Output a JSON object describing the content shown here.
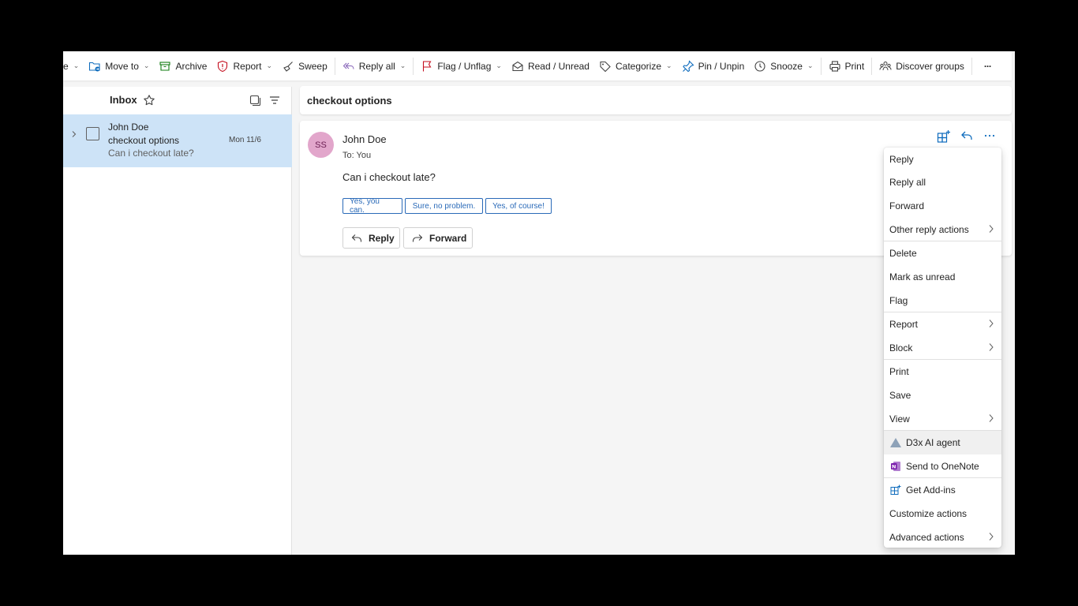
{
  "toolbar": {
    "truncated_label": "e",
    "move_to": "Move to",
    "archive": "Archive",
    "report": "Report",
    "sweep": "Sweep",
    "reply_all": "Reply all",
    "flag_unflag": "Flag / Unflag",
    "read_unread": "Read / Unread",
    "categorize": "Categorize",
    "pin_unpin": "Pin / Unpin",
    "snooze": "Snooze",
    "print": "Print",
    "discover_groups": "Discover groups",
    "more": "···"
  },
  "list": {
    "title": "Inbox",
    "message": {
      "sender": "John Doe",
      "subject": "checkout options",
      "preview": "Can i checkout late?",
      "date": "Mon 11/6"
    }
  },
  "reading": {
    "subject": "checkout options",
    "avatar_initials": "SS",
    "avatar_color": "#e2a6cb",
    "sender": "John Doe",
    "to": "To:  You",
    "body": "Can i checkout late?",
    "suggestions": [
      "Yes, you can.",
      "Sure, no problem.",
      "Yes, of course!"
    ],
    "reply_button": "Reply",
    "forward_button": "Forward"
  },
  "menu": {
    "items": [
      {
        "label": "Reply"
      },
      {
        "label": "Reply all"
      },
      {
        "label": "Forward"
      },
      {
        "label": "Other reply actions"
      },
      {
        "label": "Delete"
      },
      {
        "label": "Mark as unread"
      },
      {
        "label": "Flag"
      },
      {
        "label": "Report"
      },
      {
        "label": "Block"
      },
      {
        "label": "Print"
      },
      {
        "label": "Save"
      },
      {
        "label": "View"
      },
      {
        "label": "D3x AI agent"
      },
      {
        "label": "Send to OneNote"
      },
      {
        "label": "Get Add-ins"
      },
      {
        "label": "Customize actions"
      },
      {
        "label": "Advanced actions"
      }
    ]
  },
  "colors": {
    "accent": "#2a6ab8",
    "selected_row": "#cde3f7",
    "onenote": "#7719aa"
  }
}
